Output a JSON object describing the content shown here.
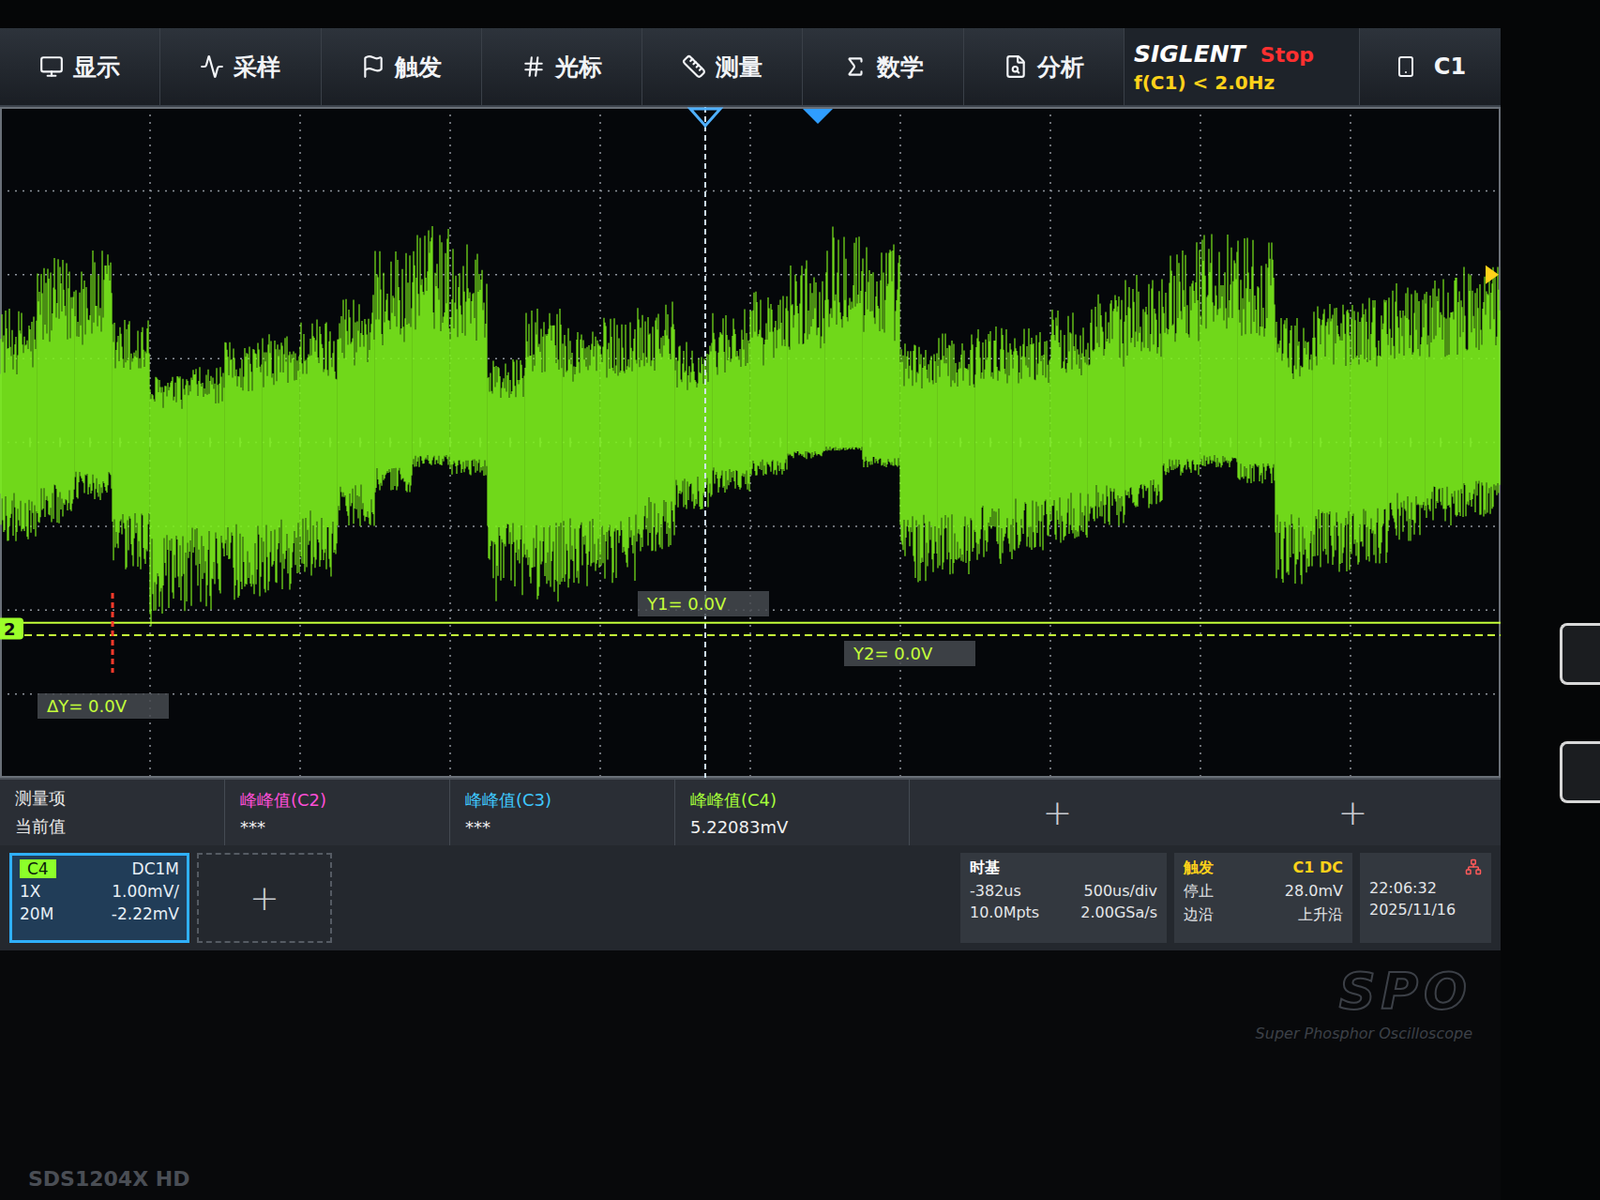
{
  "menu": [
    {
      "label": "显示"
    },
    {
      "label": "采样"
    },
    {
      "label": "触发"
    },
    {
      "label": "光标"
    },
    {
      "label": "测量"
    },
    {
      "label": "数学"
    },
    {
      "label": "分析"
    }
  ],
  "brand": "SIGLENT",
  "run_state": "Stop",
  "trigger_frequency": "f(C1) < 2.0Hz",
  "active_channel": "C1",
  "trace_marker": {
    "label": "2",
    "level": -2.22
  },
  "cursors": [
    {
      "label": "Y1= 0.0V",
      "level": -2.15
    },
    {
      "label": "Y2= 0.0V",
      "level": -2.3
    }
  ],
  "cursor_delta": "ΔY= 0.0V",
  "waveform": {
    "high": [
      1.6,
      2.2,
      2.3,
      1.5,
      0.8,
      0.9,
      1.2,
      1.3,
      1.5,
      1.8,
      2.3,
      2.6,
      2.4,
      1.0,
      1.6,
      1.4,
      1.5,
      1.7,
      1.2,
      1.6,
      1.8,
      2.2,
      2.7,
      2.4,
      1.2,
      1.3,
      1.4,
      1.4,
      1.6,
      1.8,
      2.0,
      2.4,
      2.6,
      2.5,
      1.5,
      1.7,
      1.8,
      1.9,
      2.0,
      2.1
    ],
    "low": [
      -1.2,
      -1.0,
      -0.7,
      -1.6,
      -2.2,
      -2.0,
      -1.9,
      -1.8,
      -1.6,
      -1.0,
      -0.6,
      -0.3,
      -0.4,
      -1.9,
      -1.9,
      -1.8,
      -1.7,
      -1.3,
      -0.8,
      -0.6,
      -0.4,
      -0.2,
      -0.1,
      -0.3,
      -1.7,
      -1.6,
      -1.5,
      -1.3,
      -1.2,
      -1.0,
      -0.8,
      -0.4,
      -0.3,
      -0.5,
      -1.7,
      -1.6,
      -1.5,
      -1.2,
      -1.0,
      -0.9
    ]
  },
  "measurements": {
    "header_label": "测量项",
    "value_label": "当前值",
    "items": [
      {
        "name": "峰峰值(C2)",
        "value": "***",
        "color": "#ff4fd8"
      },
      {
        "name": "峰峰值(C3)",
        "value": "***",
        "color": "#3fc8ff"
      },
      {
        "name": "峰峰值(C4)",
        "value": "5.22083mV",
        "color": "#a6ff3a"
      }
    ],
    "add_slots": [
      "+",
      "+"
    ]
  },
  "channel": {
    "name": "C4",
    "coupling": "DC1M",
    "probe": "1X",
    "scale": "1.00mV/",
    "bandwidth": "20M",
    "offset": "-2.22mV"
  },
  "add_channel": "+",
  "timebase": {
    "title": "时基",
    "delay": "-382us",
    "scale": "500us/div",
    "memory": "10.0Mpts",
    "sample_rate": "2.00GSa/s"
  },
  "trigger": {
    "title": "触发",
    "source": "C1 DC",
    "mode": "停止",
    "level": "28.0mV",
    "type": "边沿",
    "slope": "上升沿"
  },
  "clock": {
    "time": "22:06:32",
    "date": "2025/11/16"
  },
  "bezel": {
    "series": "SPO",
    "tagline": "Super Phosphor Oscilloscope",
    "model": "SDS1204X HD"
  }
}
